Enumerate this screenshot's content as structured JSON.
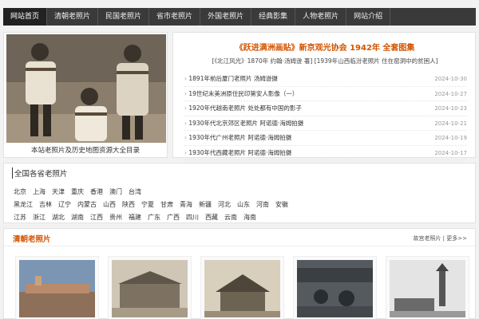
{
  "nav": {
    "items": [
      {
        "label": "网站首页",
        "active": true
      },
      {
        "label": "清朝老照片"
      },
      {
        "label": "民国老照片"
      },
      {
        "label": "省市老照片"
      },
      {
        "label": "外国老照片"
      },
      {
        "label": "经典影集"
      },
      {
        "label": "人物老照片"
      },
      {
        "label": "网站介绍"
      }
    ]
  },
  "hero": {
    "caption": "本站老照片及历史地图资源大全目录"
  },
  "news": {
    "headline": "《跃进满洲画贴》新京观光协会 1942年 全套图集",
    "subline": "[《北江风光》1870年 约翰·汤姆逊 著] [1939年山西临汾老照片 住在窑洞中的贫困人]",
    "items": [
      {
        "title": "1891年前后厦门老照片 汤姆逊摄",
        "date": "2024-10-30"
      },
      {
        "title": "19世纪末美洲原住民印第安人影像（一）",
        "date": "2024-10-27"
      },
      {
        "title": "1920年代越南老照片 处处都有中国的影子",
        "date": "2024-10-23"
      },
      {
        "title": "1930年代北京郊区老照片 阿诺德·海姆拍摄",
        "date": "2024-10-21"
      },
      {
        "title": "1930年代广州老照片 阿诺德·海姆拍摄",
        "date": "2024-10-19"
      },
      {
        "title": "1930年代西藏老照片 阿诺德·海姆拍摄",
        "date": "2024-10-17"
      }
    ]
  },
  "provinces": {
    "title": "全国各省老照片",
    "rows": [
      [
        "北京",
        "上海",
        "天津",
        "重庆",
        "香港",
        "澳门",
        "台湾"
      ],
      [
        "黑龙江",
        "吉林",
        "辽宁",
        "内蒙古",
        "山西",
        "陕西",
        "宁夏",
        "甘肃",
        "青海",
        "新疆",
        "河北",
        "山东",
        "河南",
        "安徽"
      ],
      [
        "江苏",
        "浙江",
        "湖北",
        "湖南",
        "江西",
        "贵州",
        "福建",
        "广东",
        "广西",
        "四川",
        "西藏",
        "云南",
        "海南"
      ]
    ]
  },
  "qing": {
    "title": "清朝老照片",
    "more": "故宫老照片 | 更多>>"
  }
}
